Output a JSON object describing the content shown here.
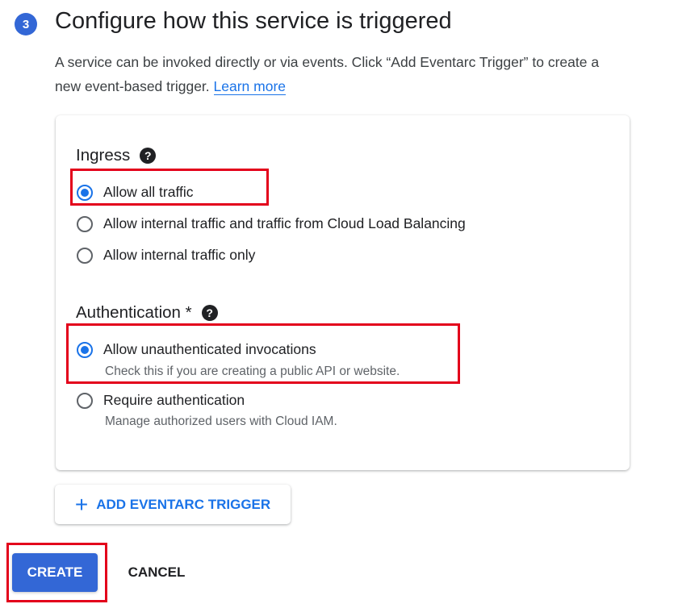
{
  "step": {
    "number": "3",
    "title": "Configure how this service is triggered"
  },
  "description": {
    "text": "A service can be invoked directly or via events. Click “Add Eventarc Trigger” to create a new event-based trigger.",
    "link": "Learn more"
  },
  "ingress": {
    "title": "Ingress",
    "help_icon": "?",
    "options": [
      {
        "label": "Allow all traffic",
        "checked": true
      },
      {
        "label": "Allow internal traffic and traffic from Cloud Load Balancing",
        "checked": false
      },
      {
        "label": "Allow internal traffic only",
        "checked": false
      }
    ]
  },
  "authentication": {
    "title": "Authentication *",
    "help_icon": "?",
    "options": [
      {
        "label": "Allow unauthenticated invocations",
        "sublabel": "Check this if you are creating a public API or website.",
        "checked": true
      },
      {
        "label": "Require authentication",
        "sublabel": "Manage authorized users with Cloud IAM.",
        "checked": false
      }
    ]
  },
  "buttons": {
    "add_trigger_icon": "+",
    "add_trigger": "ADD EVENTARC TRIGGER",
    "create": "CREATE",
    "cancel": "CANCEL"
  },
  "colors": {
    "accent": "#1a73e8",
    "primary_button": "#3367d6",
    "highlight": "#e3001b"
  }
}
